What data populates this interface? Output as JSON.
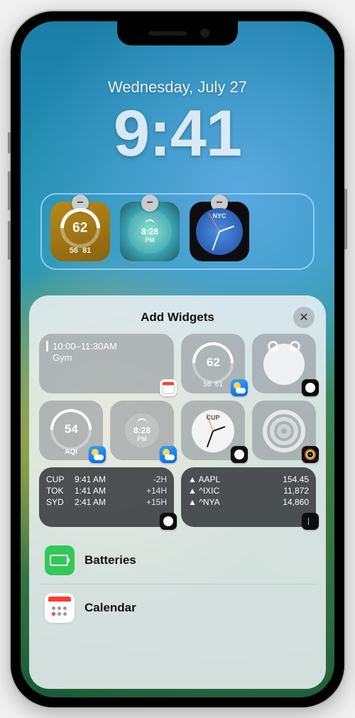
{
  "lock": {
    "date": "Wednesday, July 27",
    "time": "9:41"
  },
  "current_widgets": {
    "weather": {
      "temp": "62",
      "low": "56",
      "high": "81"
    },
    "sunrise": {
      "icon": "sunrise",
      "time": "8:28",
      "period": "PM"
    },
    "world_clock": {
      "city": "NYC"
    }
  },
  "sheet": {
    "title": "Add Widgets",
    "suggestions": {
      "calendar_event": {
        "time": "10:00–11:30AM",
        "title": "Gym"
      },
      "weather_gauge": {
        "temp": "62",
        "low": "56",
        "high": "81"
      },
      "alarm": true,
      "aqi": {
        "value": "54",
        "label": "AQI"
      },
      "sunrise": {
        "time": "8:28",
        "period": "PM"
      },
      "city_clock": {
        "label": "CUP"
      },
      "fitness": true,
      "timezones": [
        {
          "code": "CUP",
          "time": "9:41 AM",
          "offset": "-2H"
        },
        {
          "code": "TOK",
          "time": "1:41 AM",
          "offset": "+14H"
        },
        {
          "code": "SYD",
          "time": "2:41 AM",
          "offset": "+15H"
        }
      ],
      "stocks": [
        {
          "symbol": "▲ AAPL",
          "value": "154.45"
        },
        {
          "symbol": "▲ ^IXIC",
          "value": "11,872"
        },
        {
          "symbol": "▲ ^NYA",
          "value": "14,860"
        }
      ]
    },
    "apps": {
      "batteries": "Batteries",
      "calendar": "Calendar"
    }
  }
}
